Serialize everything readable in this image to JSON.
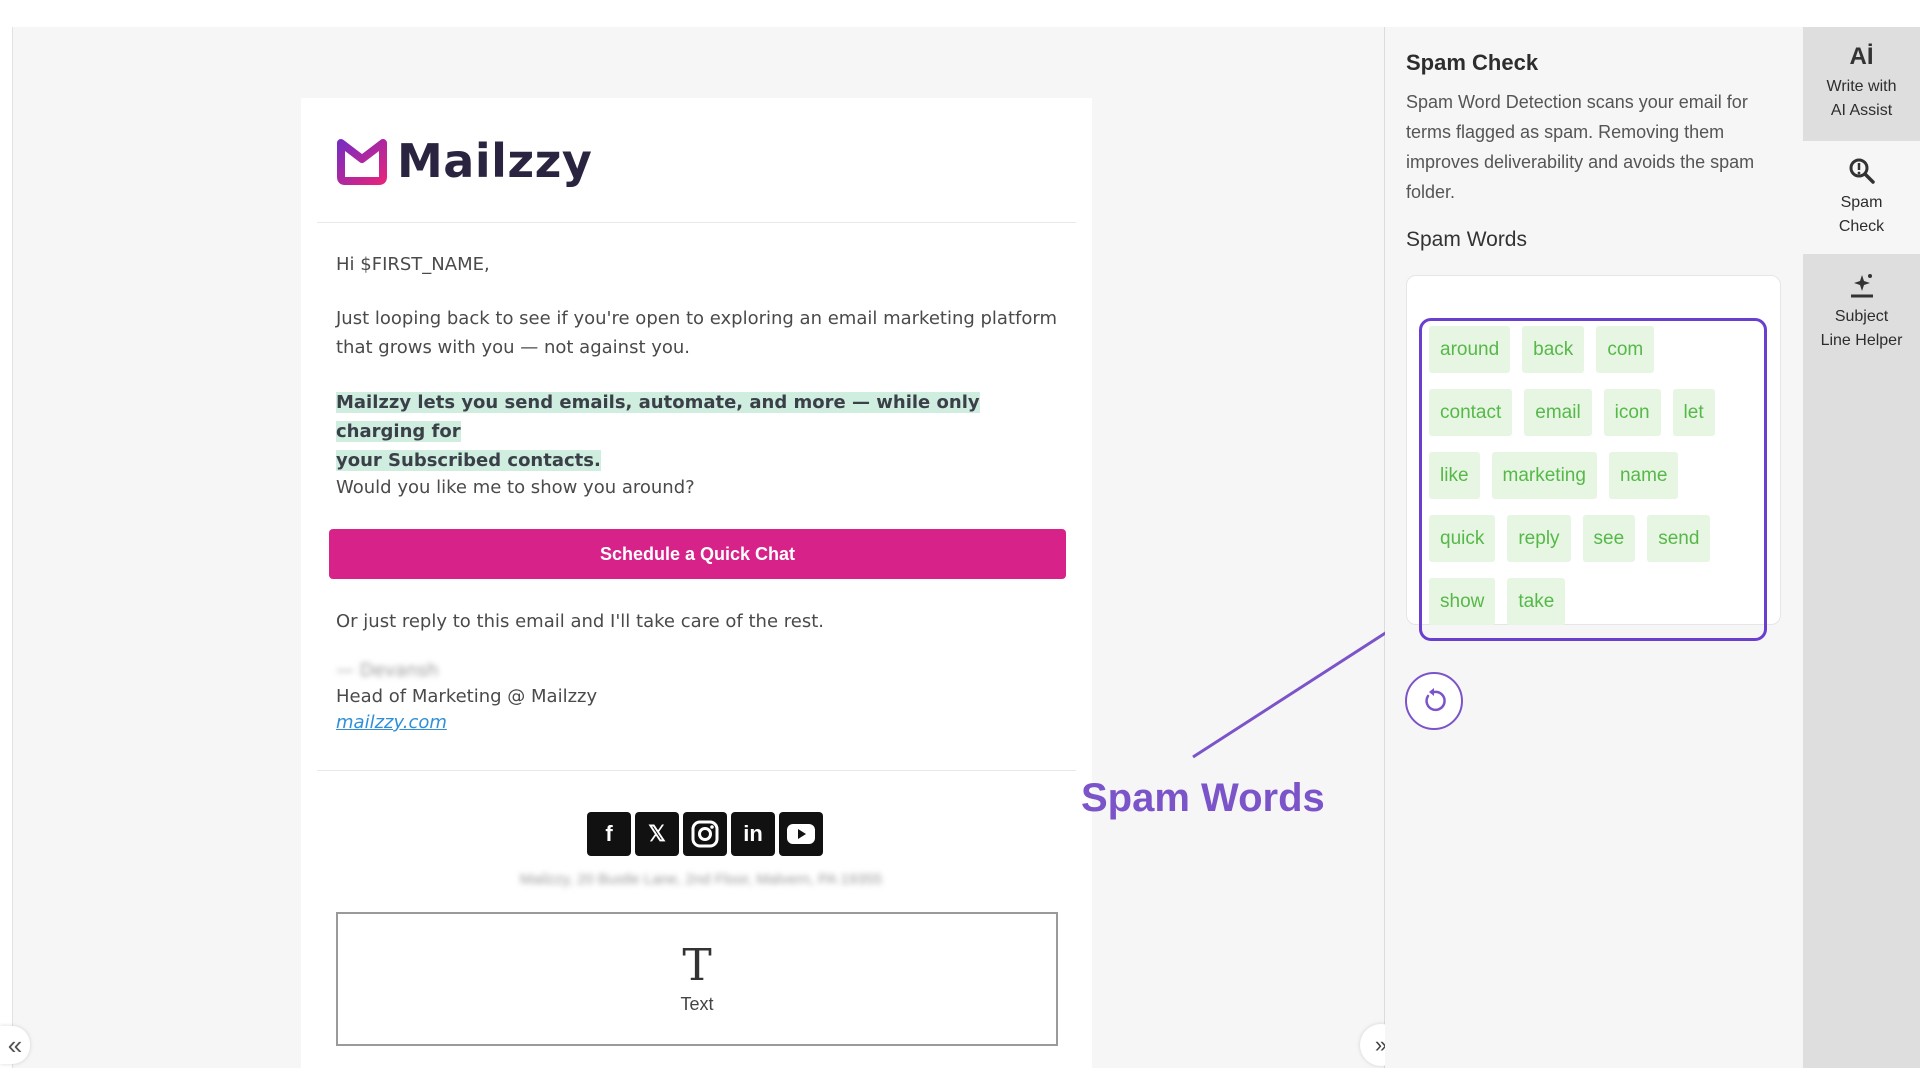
{
  "email": {
    "logo_text": "Mailzzy",
    "greeting": "Hi $FIRST_NAME,",
    "para1_line1": "Just looping back to see if you're open to exploring an email marketing platform",
    "para1_line2": "that grows with you — not against you.",
    "highlight_line1": "Mailzzy lets you send emails, automate, and more — while only charging for",
    "highlight_line2": "your Subscribed contacts.",
    "question": "Would you like me to show you around?",
    "cta_label": "Schedule a Quick Chat",
    "reply_text": "Or just reply to this email and I'll take care of the rest.",
    "sig_name": "— Devansh",
    "sig_title": "Head of Marketing @ Mailzzy",
    "sig_link": "mailzzy.com",
    "address": "Mailzzy, 20 Bustle Lane, 2nd Floor, Malvern, PA 19355",
    "text_block_label": "Text",
    "socials": [
      "facebook-icon",
      "x-icon",
      "instagram-icon",
      "linkedin-icon",
      "youtube-icon"
    ]
  },
  "annotation": {
    "label": "Spam Words",
    "color": "#7b54c9"
  },
  "spam_panel": {
    "title": "Spam Check",
    "description": "Spam Word Detection scans your email for terms flagged as spam. Removing them improves deliverability and avoids the spam folder.",
    "words_title": "Spam Words",
    "word_rows": [
      [
        "around",
        "back",
        "com"
      ],
      [
        "contact",
        "email",
        "icon",
        "let"
      ],
      [
        "like",
        "marketing",
        "name"
      ],
      [
        "quick",
        "reply",
        "see",
        "send"
      ],
      [
        "show",
        "take"
      ]
    ]
  },
  "rail": {
    "ai_label_1": "Write with",
    "ai_label_2": "AI Assist",
    "spam_label_1": "Spam",
    "spam_label_2": "Check",
    "subject_label_1": "Subject",
    "subject_label_2": "Line Helper"
  },
  "colors": {
    "brand_pink": "#d7228a",
    "accent_purple": "#6a3fce",
    "chip_bg": "#e6f6e2",
    "chip_text": "#57b84a"
  }
}
